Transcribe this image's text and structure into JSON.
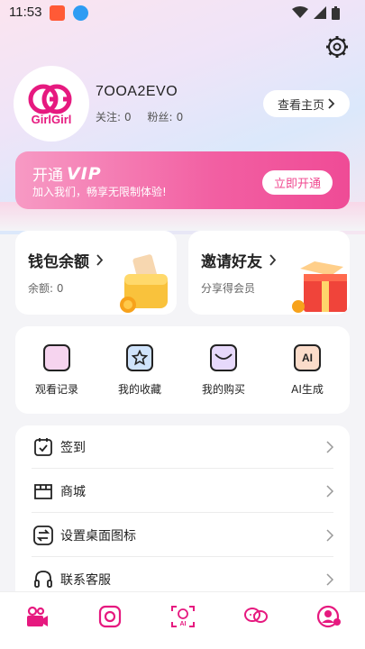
{
  "status_bar": {
    "time": "11:53"
  },
  "profile": {
    "username": "7OOA2EVO",
    "follow_label": "关注:",
    "follow_count": "0",
    "fans_label": "粉丝:",
    "fans_count": "0",
    "home_button": "查看主页",
    "avatar_text": "GirlGirl"
  },
  "vip": {
    "open_label": "开通",
    "vip_word": "VIP",
    "subtitle": "加入我们，畅享无限制体验!",
    "button": "立即开通"
  },
  "wallet": {
    "title": "钱包余额",
    "balance_label": "余额:",
    "balance": "0"
  },
  "invite": {
    "title": "邀请好友",
    "subtitle": "分享得会员"
  },
  "quick_actions": [
    {
      "label": "观看记录",
      "icon": "history-icon"
    },
    {
      "label": "我的收藏",
      "icon": "star-icon"
    },
    {
      "label": "我的购买",
      "icon": "purchase-icon"
    },
    {
      "label": "AI生成",
      "icon": "ai-icon",
      "badge": "AI"
    }
  ],
  "menu": [
    {
      "label": "签到",
      "icon": "calendar-check-icon"
    },
    {
      "label": "商城",
      "icon": "store-icon"
    },
    {
      "label": "设置桌面图标",
      "icon": "swap-icon"
    },
    {
      "label": "联系客服",
      "icon": "headset-icon"
    }
  ],
  "bottom_nav": [
    "video-icon",
    "record-icon",
    "ai-face-icon",
    "community-icon",
    "profile-icon"
  ],
  "colors": {
    "accent": "#e6197f",
    "vip_pink": "#f25fa2"
  }
}
